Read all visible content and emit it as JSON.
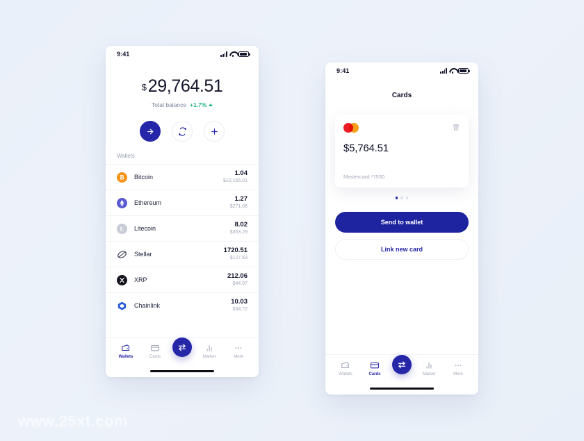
{
  "watermark": "www.25xt.com",
  "colors": {
    "accent": "#2626a8",
    "accent_button": "#1e23a0",
    "positive": "#1fb584",
    "page_background": "#eaf0f9",
    "muted_text": "#a3a8bb"
  },
  "wallets_screen": {
    "status_bar": {
      "time": "9:41",
      "signal_icon": "signal-bars-icon",
      "wifi_icon": "wifi-icon",
      "battery_icon": "battery-icon"
    },
    "balance": {
      "currency_symbol": "$",
      "amount": "29,764.51",
      "label": "Total balance",
      "change": "+1.7%",
      "change_direction_icon": "caret-up-icon"
    },
    "actions": [
      {
        "name": "send",
        "icon": "arrow-right-icon",
        "style": "primary"
      },
      {
        "name": "exchange",
        "icon": "refresh-swap-icon",
        "style": "outline"
      },
      {
        "name": "add",
        "icon": "plus-icon",
        "style": "outline"
      }
    ],
    "list_title": "Wallets",
    "wallets": [
      {
        "name": "Bitcoin",
        "icon": "bitcoin-icon",
        "color": "#f7931a",
        "amount": "1.04",
        "fiat": "$10,165.01"
      },
      {
        "name": "Ethereum",
        "icon": "ethereum-icon",
        "color": "#5a5ad6",
        "amount": "1.27",
        "fiat": "$271.06"
      },
      {
        "name": "Litecoin",
        "icon": "litecoin-icon",
        "color": "#c9ccd6",
        "amount": "8.02",
        "fiat": "$353.29"
      },
      {
        "name": "Stellar",
        "icon": "stellar-icon",
        "color": "#2c2f45",
        "amount": "1720.51",
        "fiat": "$127.63"
      },
      {
        "name": "XRP",
        "icon": "xrp-icon",
        "color": "#14141c",
        "amount": "212.06",
        "fiat": "$44.97"
      },
      {
        "name": "Chainlink",
        "icon": "chainlink-icon",
        "color": "#2a5ada",
        "amount": "10.03",
        "fiat": "$34.72"
      }
    ],
    "tabs": [
      {
        "label": "Wallets",
        "icon": "wallet-icon",
        "active": true
      },
      {
        "label": "Cards",
        "icon": "card-icon",
        "active": false
      },
      {
        "label": "",
        "icon": "swap-icon",
        "active": false
      },
      {
        "label": "Market",
        "icon": "chart-bars-icon",
        "active": false
      },
      {
        "label": "More",
        "icon": "ellipsis-icon",
        "active": false
      }
    ]
  },
  "cards_screen": {
    "status_bar": {
      "time": "9:41",
      "signal_icon": "signal-bars-icon",
      "wifi_icon": "wifi-icon",
      "battery_icon": "battery-icon"
    },
    "title": "Cards",
    "card": {
      "brand_icon": "mastercard-icon",
      "delete_icon": "trash-icon",
      "amount": "$5,764.51",
      "meta": "Mastercard *7530"
    },
    "pagination": {
      "count": 3,
      "active_index": 0
    },
    "buttons": {
      "primary_label": "Send to wallet",
      "secondary_label": "Link new card"
    },
    "tabs": [
      {
        "label": "Wallets",
        "icon": "wallet-icon",
        "active": false
      },
      {
        "label": "Cards",
        "icon": "card-icon",
        "active": true
      },
      {
        "label": "",
        "icon": "swap-icon",
        "active": false
      },
      {
        "label": "Market",
        "icon": "chart-bars-icon",
        "active": false
      },
      {
        "label": "More",
        "icon": "ellipsis-icon",
        "active": false
      }
    ]
  }
}
